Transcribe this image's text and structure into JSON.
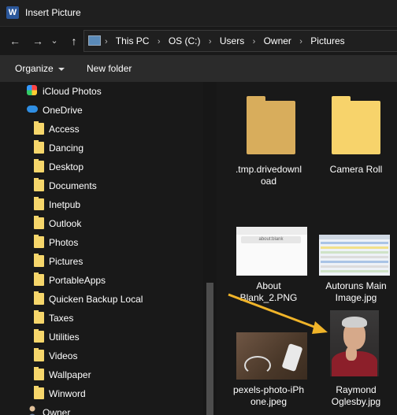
{
  "window": {
    "title": "Insert Picture",
    "app_badge": "W"
  },
  "nav": {
    "back_icon": "←",
    "forward_icon": "→",
    "dropdown_icon": "⌄",
    "up_icon": "↑"
  },
  "breadcrumb": [
    "This PC",
    "OS (C:)",
    "Users",
    "Owner",
    "Pictures"
  ],
  "breadcrumb_sep": "›",
  "toolbar": {
    "organize": "Organize",
    "new_folder": "New folder"
  },
  "sidebar": {
    "items": [
      {
        "label": "iCloud Photos"
      },
      {
        "label": "OneDrive"
      },
      {
        "label": "Access"
      },
      {
        "label": "Dancing"
      },
      {
        "label": "Desktop"
      },
      {
        "label": "Documents"
      },
      {
        "label": "Inetpub"
      },
      {
        "label": "Outlook"
      },
      {
        "label": "Photos"
      },
      {
        "label": "Pictures"
      },
      {
        "label": "PortableApps"
      },
      {
        "label": "Quicken Backup Local"
      },
      {
        "label": "Taxes"
      },
      {
        "label": "Utilities"
      },
      {
        "label": "Videos"
      },
      {
        "label": "Wallpaper"
      },
      {
        "label": "Winword"
      },
      {
        "label": "Owner"
      }
    ]
  },
  "files": [
    {
      "name_line1": ".tmp.drivedownl",
      "name_line2": "oad"
    },
    {
      "name_line1": "Camera Roll",
      "name_line2": ""
    },
    {
      "name_line1": "About",
      "name_line2": "Blank_2.PNG"
    },
    {
      "name_line1": "Autoruns Main",
      "name_line2": "Image.jpg"
    },
    {
      "name_line1": "pexels-photo-iPh",
      "name_line2": "one.jpeg"
    },
    {
      "name_line1": "Raymond",
      "name_line2": "Oglesby.jpg"
    }
  ],
  "thumb_text": {
    "about_blank_url": "about:blank"
  },
  "colors": {
    "folder": "#f7d36b",
    "arrow": "#f0b429",
    "onedrive": "#2f8ee3"
  }
}
